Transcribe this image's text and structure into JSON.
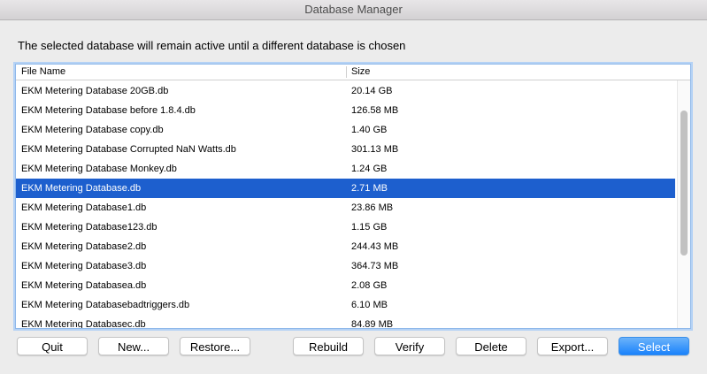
{
  "window": {
    "title": "Database Manager"
  },
  "message": "The selected database will remain active until a different database is chosen",
  "table": {
    "columns": [
      "File Name",
      "Size"
    ],
    "rows": [
      {
        "name": "EKM Metering Database 20GB.db",
        "size": "20.14 GB"
      },
      {
        "name": "EKM Metering Database before 1.8.4.db",
        "size": "126.58 MB"
      },
      {
        "name": "EKM Metering Database copy.db",
        "size": "1.40 GB"
      },
      {
        "name": "EKM Metering Database Corrupted NaN Watts.db",
        "size": "301.13 MB"
      },
      {
        "name": "EKM Metering Database Monkey.db",
        "size": "1.24 GB"
      },
      {
        "name": "EKM Metering Database.db",
        "size": "2.71 MB",
        "selected": true
      },
      {
        "name": "EKM Metering Database1.db",
        "size": "23.86 MB"
      },
      {
        "name": "EKM Metering Database123.db",
        "size": "1.15 GB"
      },
      {
        "name": "EKM Metering Database2.db",
        "size": "244.43 MB"
      },
      {
        "name": "EKM Metering Database3.db",
        "size": "364.73 MB"
      },
      {
        "name": "EKM Metering Databasea.db",
        "size": "2.08 GB"
      },
      {
        "name": "EKM Metering Databasebadtriggers.db",
        "size": "6.10 MB"
      },
      {
        "name": "EKM Metering Databasec.db",
        "size": "84.89 MB"
      }
    ]
  },
  "buttons": {
    "quit": "Quit",
    "new": "New...",
    "restore": "Restore...",
    "rebuild": "Rebuild",
    "verify": "Verify",
    "delete": "Delete",
    "export": "Export...",
    "select": "Select"
  },
  "colors": {
    "selection": "#1d5fce",
    "primary_button": "#1a82fb",
    "focus_ring": "#8fb8ea"
  }
}
